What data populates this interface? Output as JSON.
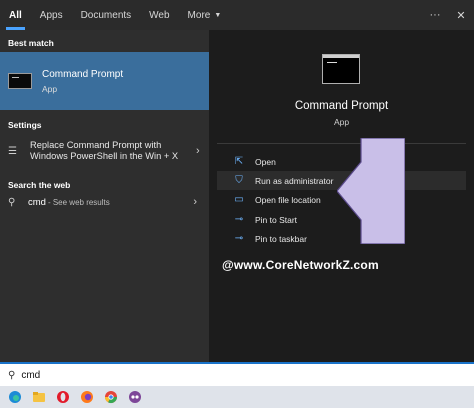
{
  "tabs": [
    "All",
    "Apps",
    "Documents",
    "Web",
    "More"
  ],
  "top_right": {
    "more_options": "···",
    "close": "✕"
  },
  "left": {
    "best_match_title": "Best match",
    "best_match": {
      "name": "Command Prompt",
      "type": "App"
    },
    "settings_title": "Settings",
    "setting_item": "Replace Command Prompt with Windows PowerShell in the Win + X",
    "web_title": "Search the web",
    "web_item": {
      "query": "cmd",
      "desc": "- See web results"
    }
  },
  "right": {
    "title": "Command Prompt",
    "sub": "App",
    "actions": [
      {
        "label": "Open",
        "icon": "open-icon"
      },
      {
        "label": "Run as administrator",
        "icon": "shield-icon"
      },
      {
        "label": "Open file location",
        "icon": "folder-icon"
      },
      {
        "label": "Pin to Start",
        "icon": "pin-icon"
      },
      {
        "label": "Pin to taskbar",
        "icon": "pin-icon"
      }
    ]
  },
  "watermark": "@www.CoreNetworkZ.com",
  "search": {
    "value": "cmd"
  },
  "taskbar": [
    "edge-icon",
    "file-explorer-icon",
    "opera-icon",
    "firefox-icon",
    "chrome-icon",
    "tor-browser-icon"
  ],
  "colors": {
    "accent": "#3a6e9c",
    "link": "#6fb6ff",
    "arrow": "#c9bfe8"
  }
}
